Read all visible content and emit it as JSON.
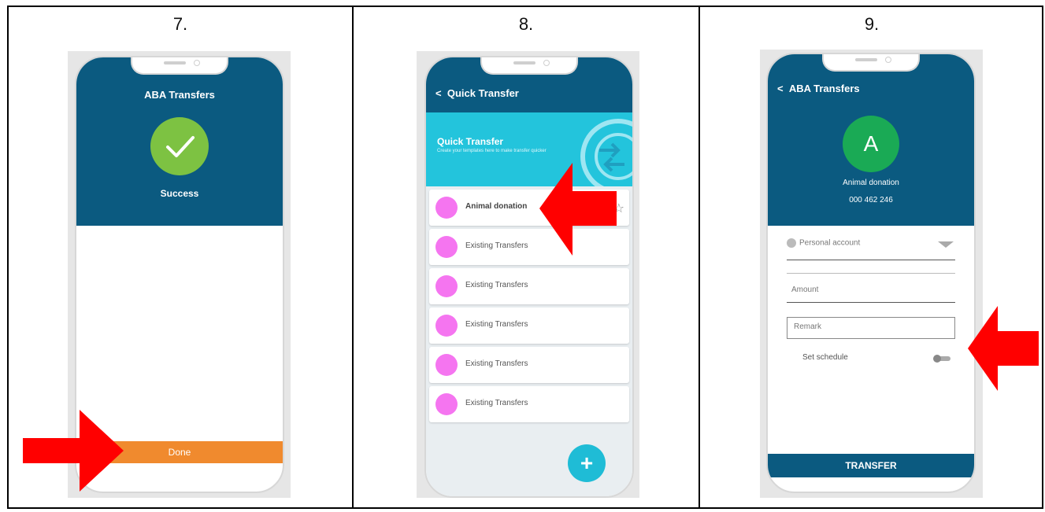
{
  "steps": [
    "7.",
    "8.",
    "9."
  ],
  "panel7": {
    "title": "ABA Transfers",
    "status": "Success",
    "done_label": "Done"
  },
  "panel8": {
    "back_glyph": "<",
    "title": "Quick Transfer",
    "banner_title": "Quick Transfer",
    "banner_subtitle": "Create your templates here to make transfer quicker",
    "items": [
      {
        "label": "Animal donation",
        "favorite": true
      },
      {
        "label": "Existing Transfers"
      },
      {
        "label": "Existing Transfers"
      },
      {
        "label": "Existing Transfers"
      },
      {
        "label": "Existing Transfers"
      },
      {
        "label": "Existing Transfers"
      }
    ],
    "star_glyph": "☆",
    "fab_glyph": "+"
  },
  "panel9": {
    "back_glyph": "<",
    "title": "ABA Transfers",
    "avatar_letter": "A",
    "recipient_name": "Animal donation",
    "recipient_number": "000 462 246",
    "account_select": "Personal account",
    "amount_placeholder": "Amount",
    "remark_placeholder": "Remark",
    "schedule_label": "Set schedule",
    "schedule_enabled": false,
    "transfer_label": "TRANSFER"
  },
  "colors": {
    "header": "#0b5a80",
    "success": "#7dc242",
    "done": "#f08a2e",
    "banner": "#23c4dc",
    "avatar_pink": "#f575f0",
    "avatar_green": "#1aaa55",
    "fab": "#1fbcd6",
    "arrow": "#ff0000"
  }
}
